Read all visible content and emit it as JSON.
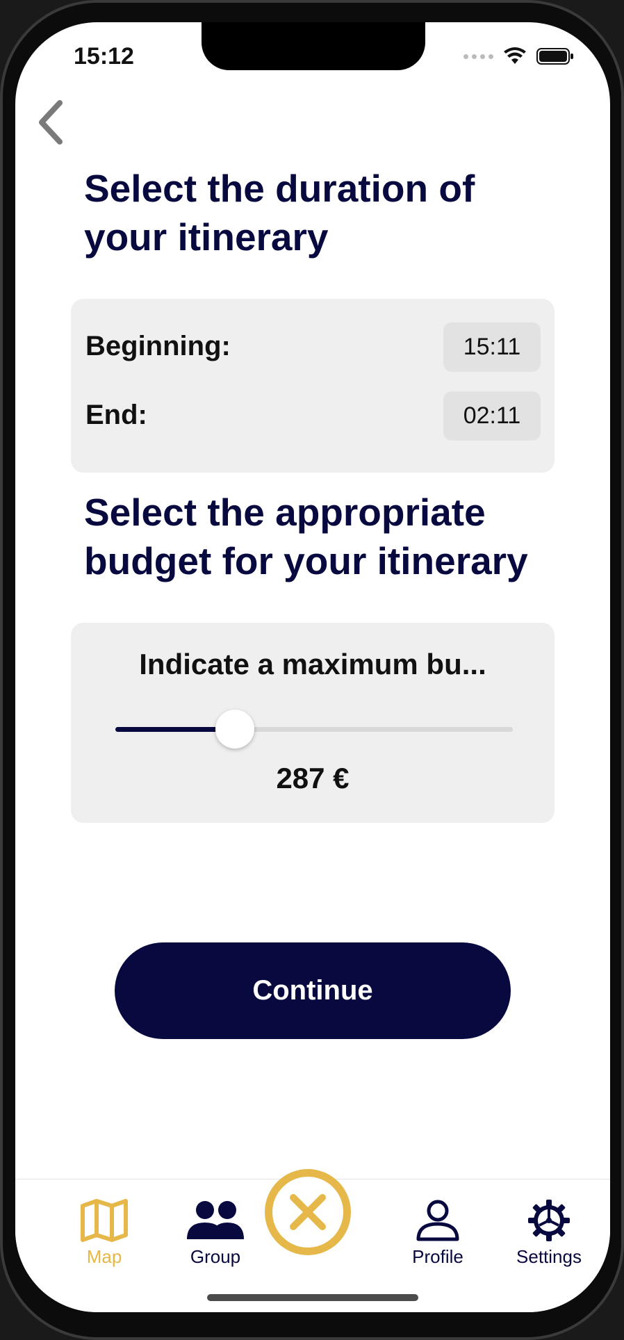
{
  "status_bar": {
    "time": "15:12"
  },
  "duration": {
    "title": "Select the duration of your itinerary",
    "beginning_label": "Beginning:",
    "beginning_value": "15:11",
    "end_label": "End:",
    "end_value": "02:11"
  },
  "budget": {
    "title": "Select the appropriate budget for your itinerary",
    "label": "Indicate a maximum bu...",
    "value_text": "287 €",
    "slider_fraction": 0.3
  },
  "continue_button": {
    "label": "Continue"
  },
  "tabbar": {
    "items": [
      {
        "label": "Map",
        "icon": "map-icon",
        "active": true
      },
      {
        "label": "Group",
        "icon": "group-icon",
        "active": false
      },
      {
        "label": "",
        "icon": "close-icon",
        "active": false
      },
      {
        "label": "Profile",
        "icon": "profile-icon",
        "active": false
      },
      {
        "label": "Settings",
        "icon": "gear-icon",
        "active": false
      }
    ]
  },
  "colors": {
    "primary": "#07093f",
    "accent": "#e6b84a",
    "card_bg": "#efefef",
    "chip_bg": "#e2e2e2"
  }
}
